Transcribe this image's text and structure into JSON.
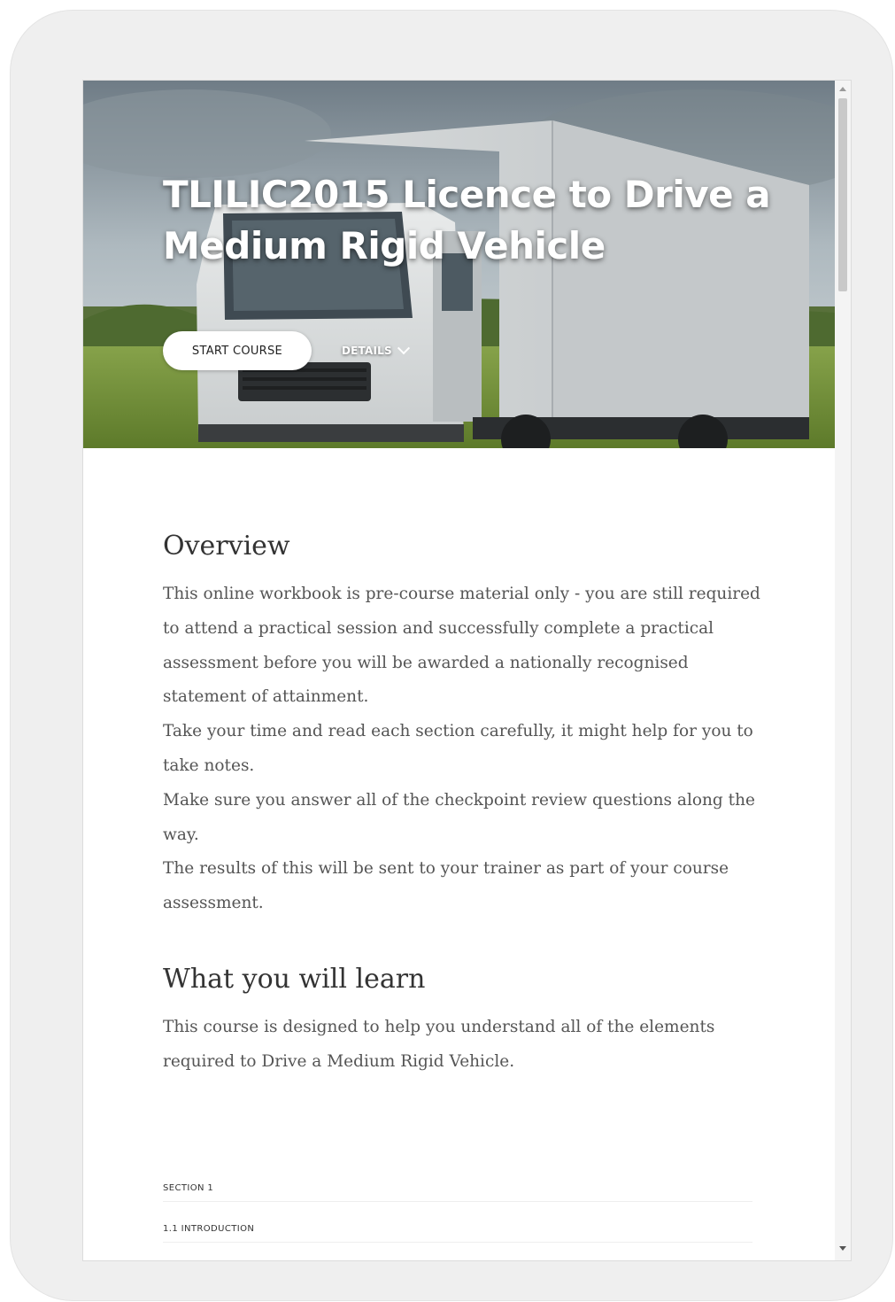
{
  "hero": {
    "title": "TLILIC2015 Licence to Drive a Medium Rigid Vehicle",
    "start_button": "START COURSE",
    "details_button": "DETAILS"
  },
  "overview": {
    "heading": "Overview",
    "paragraphs": [
      "This online workbook is pre-course material only - you are still required to attend a practical session and successfully complete a practical assessment before you will be awarded a nationally recognised statement of attainment.",
      "Take your time and read each section carefully, it might help for you to take notes.",
      "Make sure you answer all of the checkpoint review questions along the way.",
      "The results of this will be sent to your trainer as part of your course assessment."
    ]
  },
  "learn": {
    "heading": "What you will learn",
    "text": "This course is designed to help you understand all of the elements required to Drive a Medium Rigid Vehicle."
  },
  "outline": {
    "section_label": "SECTION 1",
    "lesson_label": "1.1 INTRODUCTION"
  },
  "colors": {
    "heading": "#333333",
    "body_text": "#555555",
    "device_frame": "#efefef"
  }
}
